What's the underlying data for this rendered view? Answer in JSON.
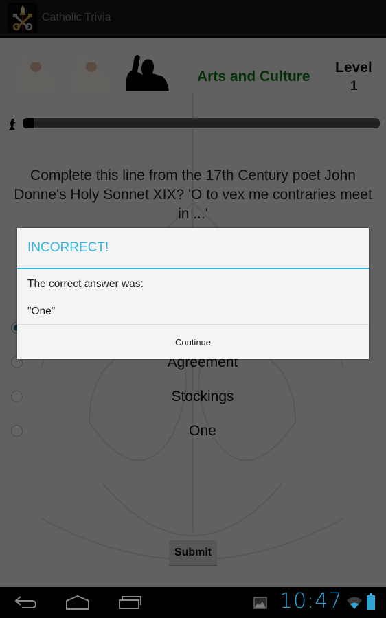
{
  "app": {
    "title": "Catholic Trivia",
    "icon": "papal-keys-icon"
  },
  "header": {
    "lives": [
      {
        "icon": "pope-life-icon",
        "state": "remaining"
      },
      {
        "icon": "pope-life-icon",
        "state": "remaining"
      },
      {
        "icon": "pope-silhouette-icon",
        "state": "lost"
      }
    ],
    "category": "Arts and Culture",
    "level_label": "Level",
    "level_value": "1"
  },
  "progress": {
    "icon": "runner-icon",
    "value_percent": 3
  },
  "question": {
    "text": "Complete this line from the 17th Century poet John Donne's Holy Sonnet XIX? 'O to vex me contraries meet in ...'"
  },
  "options": [
    {
      "label": "",
      "selected": true
    },
    {
      "label": "Agreement",
      "selected": false
    },
    {
      "label": "Stockings",
      "selected": false
    },
    {
      "label": "One",
      "selected": false
    }
  ],
  "submit_label": "Submit",
  "dialog": {
    "title": "INCORRECT!",
    "message_line1": "The correct answer was:",
    "message_line2": "\"One\"",
    "button_label": "Continue",
    "accent_color": "#33b5e5"
  },
  "navbar": {
    "back": "back-icon",
    "home": "home-icon",
    "recents": "recent-apps-icon"
  },
  "status": {
    "notification_icon": "image-notification-icon",
    "time": "10:47",
    "wifi": "wifi-icon",
    "battery": "battery-icon",
    "accent_color": "#2ea3d4"
  }
}
